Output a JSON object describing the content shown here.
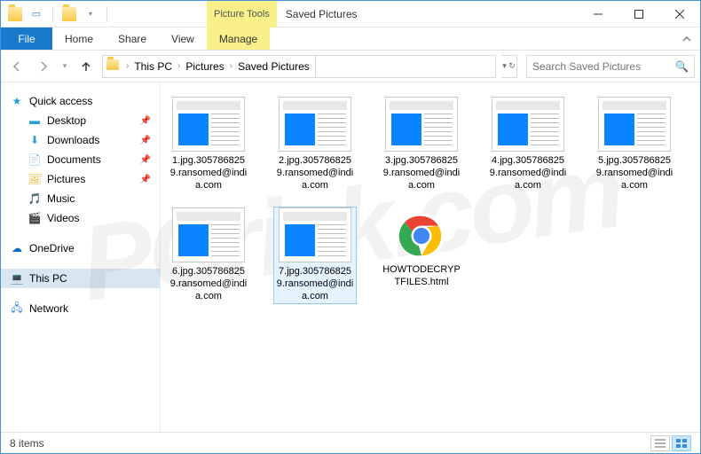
{
  "window": {
    "context_tab_group": "Picture Tools",
    "title": "Saved Pictures"
  },
  "ribbon": {
    "file": "File",
    "tabs": [
      "Home",
      "Share",
      "View"
    ],
    "context_tab": "Manage"
  },
  "breadcrumb": {
    "parts": [
      "This PC",
      "Pictures",
      "Saved Pictures"
    ]
  },
  "search": {
    "placeholder": "Search Saved Pictures"
  },
  "sidebar": {
    "quick_access": "Quick access",
    "quick_items": [
      "Desktop",
      "Downloads",
      "Documents",
      "Pictures",
      "Music",
      "Videos"
    ],
    "onedrive": "OneDrive",
    "this_pc": "This PC",
    "network": "Network"
  },
  "files": [
    {
      "name": "1.jpg.3057868259.ransomed@india.com",
      "type": "file"
    },
    {
      "name": "2.jpg.3057868259.ransomed@india.com",
      "type": "file"
    },
    {
      "name": "3.jpg.3057868259.ransomed@india.com",
      "type": "file"
    },
    {
      "name": "4.jpg.3057868259.ransomed@india.com",
      "type": "file"
    },
    {
      "name": "5.jpg.3057868259.ransomed@india.com",
      "type": "file"
    },
    {
      "name": "6.jpg.3057868259.ransomed@india.com",
      "type": "file"
    },
    {
      "name": "7.jpg.3057868259.ransomed@india.com",
      "type": "file",
      "selected": true
    },
    {
      "name": "HOWTODECRYPTFILES.html",
      "type": "html"
    }
  ],
  "status": {
    "count_text": "8 items"
  },
  "watermark": "PCrisk.com"
}
